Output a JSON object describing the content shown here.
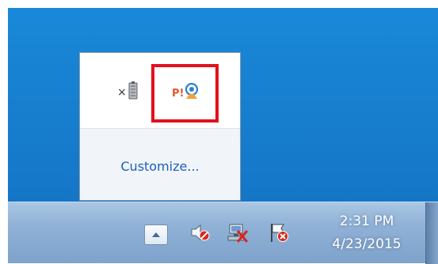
{
  "overflow_panel": {
    "customize_label": "Customize...",
    "icons": [
      {
        "name": "battery-icon",
        "prefix": "×"
      },
      {
        "name": "tray-app-icon",
        "badge": "P!"
      }
    ],
    "highlight_color": "#e3101a"
  },
  "taskbar": {
    "clock": {
      "time": "2:31 PM",
      "date": "4/23/2015"
    },
    "tray_icons": [
      "show-hidden-icons",
      "speaker-muted-icon",
      "network-disconnected-icon",
      "action-center-flag-error-icon"
    ]
  },
  "colors": {
    "desktop": "#1680d0",
    "link": "#1d5fb8",
    "taskbar": "#8fb1d6"
  }
}
